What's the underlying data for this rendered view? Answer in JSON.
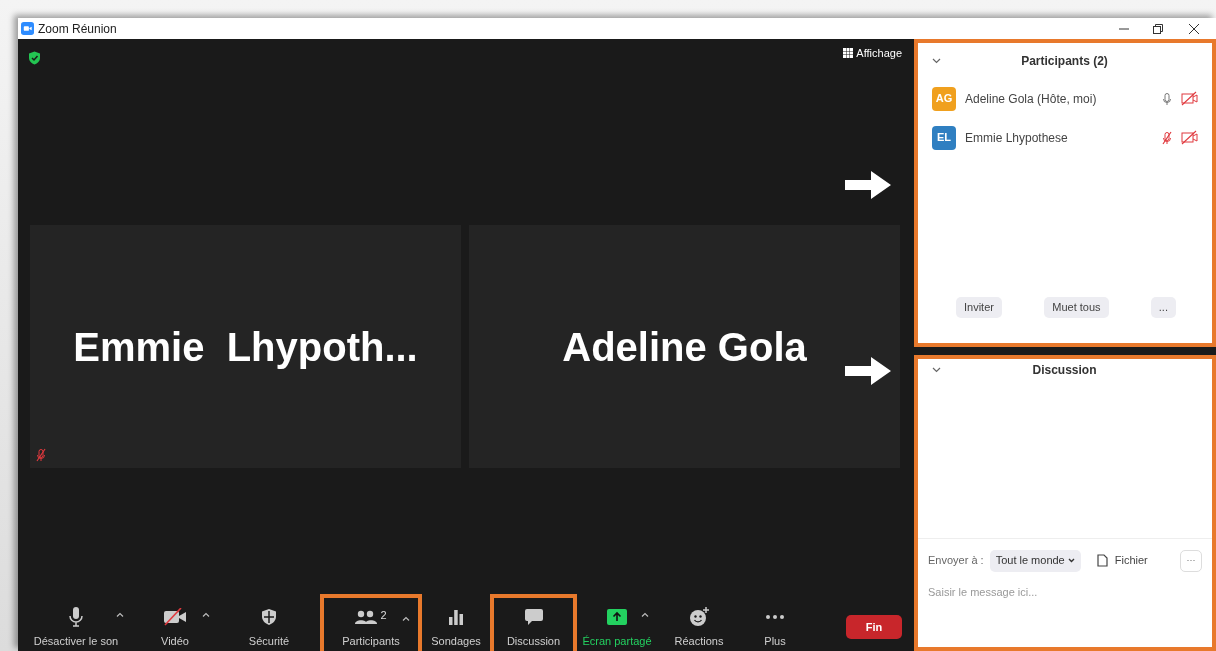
{
  "window": {
    "title": "Zoom Réunion"
  },
  "meeting": {
    "view_button": "Affichage",
    "tiles": [
      {
        "name": "Emmie  Lhypoth...",
        "muted": true
      },
      {
        "name": "Adeline Gola",
        "muted": false
      }
    ]
  },
  "toolbar": {
    "items": [
      {
        "kind": "mic",
        "label": "Désactiver le son",
        "caret": true,
        "highlighted": false
      },
      {
        "kind": "video",
        "label": "Vidéo",
        "caret": true,
        "highlighted": false
      },
      {
        "kind": "security",
        "label": "Sécurité",
        "caret": false,
        "highlighted": false
      },
      {
        "kind": "participants",
        "label": "Participants",
        "badge": "2",
        "caret": true,
        "highlighted": true
      },
      {
        "kind": "polls",
        "label": "Sondages",
        "caret": false,
        "highlighted": false
      },
      {
        "kind": "chat",
        "label": "Discussion",
        "caret": false,
        "highlighted": true
      },
      {
        "kind": "share",
        "label": "Écran partagé",
        "caret": true,
        "highlighted": false
      },
      {
        "kind": "reactions",
        "label": "Réactions",
        "caret": false,
        "highlighted": false
      },
      {
        "kind": "more",
        "label": "Plus",
        "caret": false,
        "highlighted": false
      }
    ],
    "end_button": "Fin"
  },
  "participants_panel": {
    "title": "Participants (2)",
    "highlighted": true,
    "participants": [
      {
        "initials": "AG",
        "name": "Adeline Gola (Hôte, moi)",
        "color": "#f0a01e",
        "mic_muted": false,
        "video_off": true
      },
      {
        "initials": "EL",
        "name": "Emmie Lhypothese",
        "color": "#2f7fc1",
        "mic_muted": true,
        "video_off": true
      }
    ],
    "buttons": [
      "Inviter",
      "Muet tous",
      "..."
    ]
  },
  "chat_panel": {
    "title": "Discussion",
    "highlighted": true,
    "send_to_label": "Envoyer à :",
    "recipient": "Tout le monde",
    "file_button": "Fichier",
    "more_button": "···",
    "placeholder": "Saisir le message ici..."
  }
}
